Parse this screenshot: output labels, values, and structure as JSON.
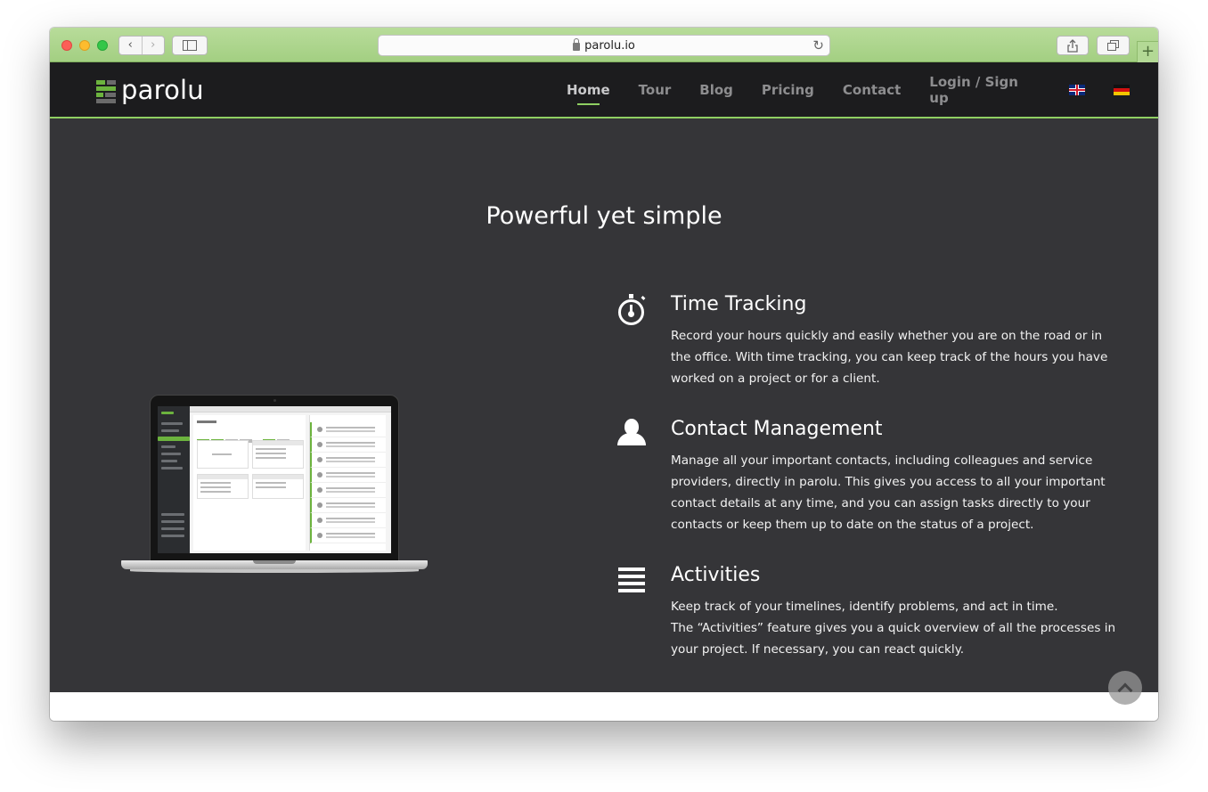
{
  "browser": {
    "url": "parolu.io",
    "back_icon": "chevron-left-icon",
    "forward_icon": "chevron-right-icon",
    "sidebar_icon": "sidebar-icon",
    "share_icon": "share-icon",
    "tabs_icon": "tabs-icon",
    "new_tab_label": "+",
    "reload_icon": "reload-icon"
  },
  "header": {
    "logo_text": "parolu",
    "nav": [
      "Home",
      "Tour",
      "Blog",
      "Pricing",
      "Contact",
      "Login / Sign up"
    ],
    "active_nav": "Home",
    "languages": [
      "English",
      "Deutsch"
    ],
    "accent_color": "#8fcf62"
  },
  "main": {
    "title": "Powerful yet simple",
    "features": [
      {
        "icon": "stopwatch-icon",
        "title": "Time Tracking",
        "text": "Record your hours quickly and easily whether you are on the road or in the office. With time tracking, you can keep track of the hours you have worked on a project or for a client."
      },
      {
        "icon": "person-icon",
        "title": "Contact Management",
        "text": "Manage all your important contacts, including colleagues and service providers, directly in parolu. This gives you access to all your important contact details at any time, and you can assign tasks directly to your contacts or keep them up to date on the status of a project."
      },
      {
        "icon": "list-icon",
        "title": "Activities",
        "text_line1": "Keep track of your timelines, identify problems, and act in time.",
        "text_line2": "The “Activities” feature gives you a quick overview of all the processes in your project. If necessary, you can react quickly."
      }
    ],
    "background_color": "#353538"
  },
  "scroll_top_icon": "chevron-up-icon"
}
